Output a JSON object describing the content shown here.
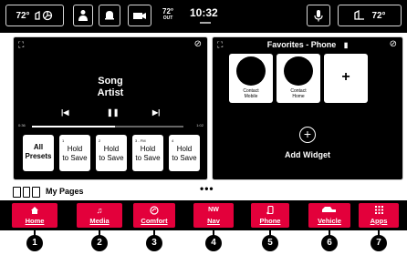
{
  "status_bar": {
    "outside_temp_left": "72°",
    "outside_temp_center": "72°",
    "outside_temp_center_unit": "OUT",
    "time": "10:32",
    "temp_right": "72°"
  },
  "media_widget": {
    "song": "Song",
    "artist": "Artist",
    "elapsed": "0:36",
    "total": "1:02",
    "progress": 0.55,
    "presets": [
      {
        "number": "",
        "label_line1": "All",
        "label_line2": "Presets"
      },
      {
        "number": "1",
        "label_line1": "Hold",
        "label_line2": "to Save"
      },
      {
        "number": "2",
        "label_line1": "Hold",
        "label_line2": "to Save"
      },
      {
        "number": "3 - FM",
        "label_line1": "Hold",
        "label_line2": "to Save"
      },
      {
        "number": "4",
        "label_line1": "Hold",
        "label_line2": "to Save"
      }
    ]
  },
  "favorites_widget": {
    "title": "Favorites - Phone",
    "contacts": [
      {
        "line1": "Contact",
        "line2": "Mobile"
      },
      {
        "line1": "Contact",
        "line2": "Home"
      }
    ],
    "add_symbol": "+",
    "add_widget_label": "Add Widget"
  },
  "my_pages": {
    "label": "My Pages",
    "more": "•••"
  },
  "nav": {
    "accent_color": "#e3003b",
    "items": [
      {
        "label": "Home",
        "icon": "home-icon"
      },
      {
        "label": "Media",
        "icon": "music-note-icon"
      },
      {
        "label": "Comfort",
        "icon": "comfort-icon"
      },
      {
        "label": "Nav",
        "icon_text": "NW",
        "icon": "compass-icon"
      },
      {
        "label": "Phone",
        "icon": "phone-icon"
      },
      {
        "label": "Vehicle",
        "icon": "car-icon"
      },
      {
        "label": "Apps",
        "icon": "apps-grid-icon"
      }
    ]
  },
  "callouts": [
    "1",
    "2",
    "3",
    "4",
    "5",
    "6",
    "7"
  ]
}
